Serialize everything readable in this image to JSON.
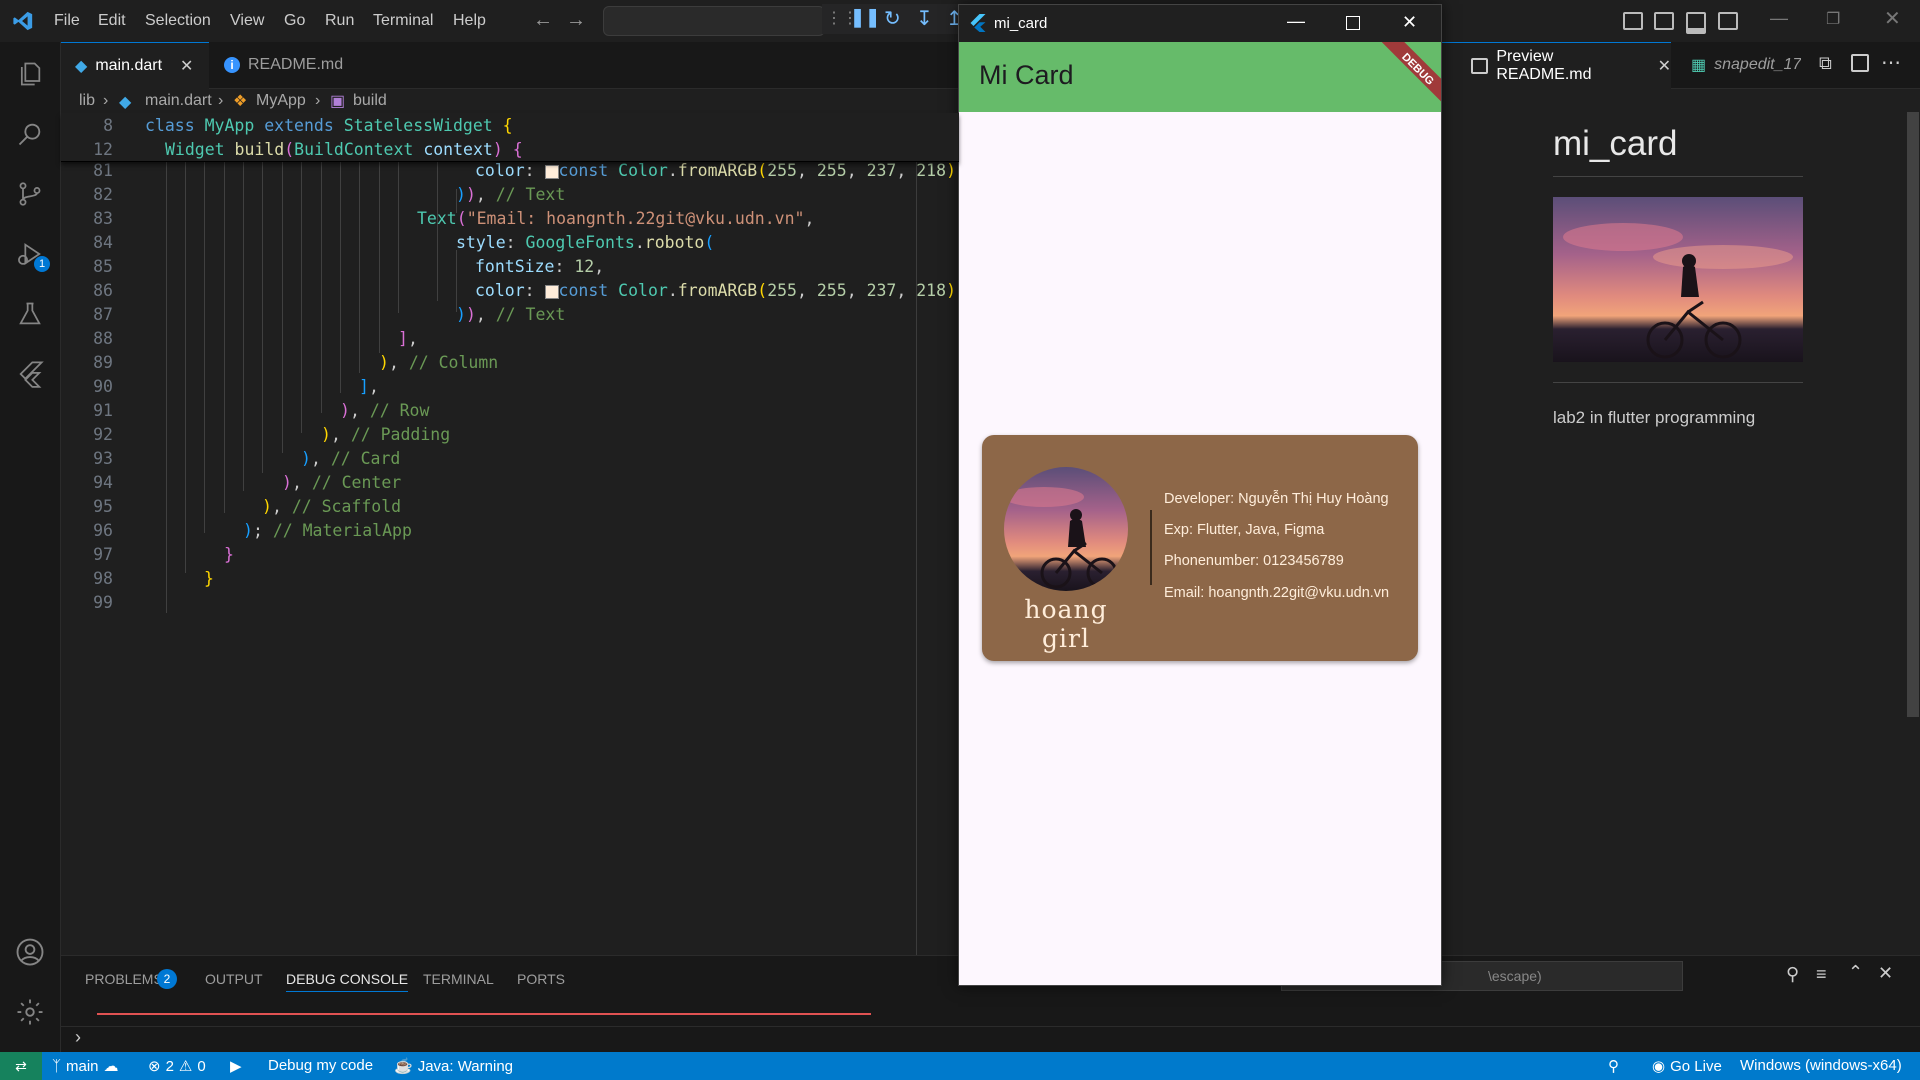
{
  "titlebar": {
    "menus": [
      "File",
      "Edit",
      "Selection",
      "View",
      "Go",
      "Run",
      "Terminal",
      "Help"
    ]
  },
  "tabs": [
    {
      "label": "main.dart",
      "active": true
    },
    {
      "label": "README.md",
      "active": false
    }
  ],
  "breadcrumb": [
    "lib",
    "main.dart",
    "MyApp",
    "build"
  ],
  "activitybar": {
    "debug_badge": "1"
  },
  "editor": {
    "sticky": [
      {
        "num": "8"
      },
      {
        "num": "12"
      }
    ],
    "line_numbers": [
      "81",
      "82",
      "83",
      "84",
      "85",
      "86",
      "87",
      "88",
      "89",
      "90",
      "91",
      "92",
      "93",
      "94",
      "95",
      "96",
      "97",
      "98",
      "99"
    ]
  },
  "app_window": {
    "title": "mi_card",
    "appbar_title": "Mi Card",
    "debug_banner": "DEBUG",
    "card": {
      "name": "hoang girl",
      "lines": [
        "Developer: Nguyễn Thị Huy Hoàng",
        "Exp: Flutter, Java, Figma",
        "Phonenumber: 0123456789",
        "Email: hoangnth.22git@vku.udn.vn"
      ]
    }
  },
  "preview": {
    "tab_label": "Preview README.md",
    "tab2_label": "snapedit_17",
    "heading": "mi_card",
    "paragraph": "lab2 in flutter programming"
  },
  "panel": {
    "tabs": [
      "PROBLEMS",
      "OUTPUT",
      "DEBUG CONSOLE",
      "TERMINAL",
      "PORTS"
    ],
    "problems_badge": "2",
    "active_tab": "DEBUG CONSOLE",
    "filter_placeholder": "\\escape)"
  },
  "statusbar": {
    "branch": "main",
    "errors": "2",
    "warnings": "0",
    "debug": "Debug my code",
    "java": "Java: Warning",
    "golive": "Go Live",
    "platform": "Windows (windows-x64)"
  },
  "colors": {
    "appbar": "#66bb6a",
    "card": "#8d6748",
    "statusbar": "#007acc"
  }
}
